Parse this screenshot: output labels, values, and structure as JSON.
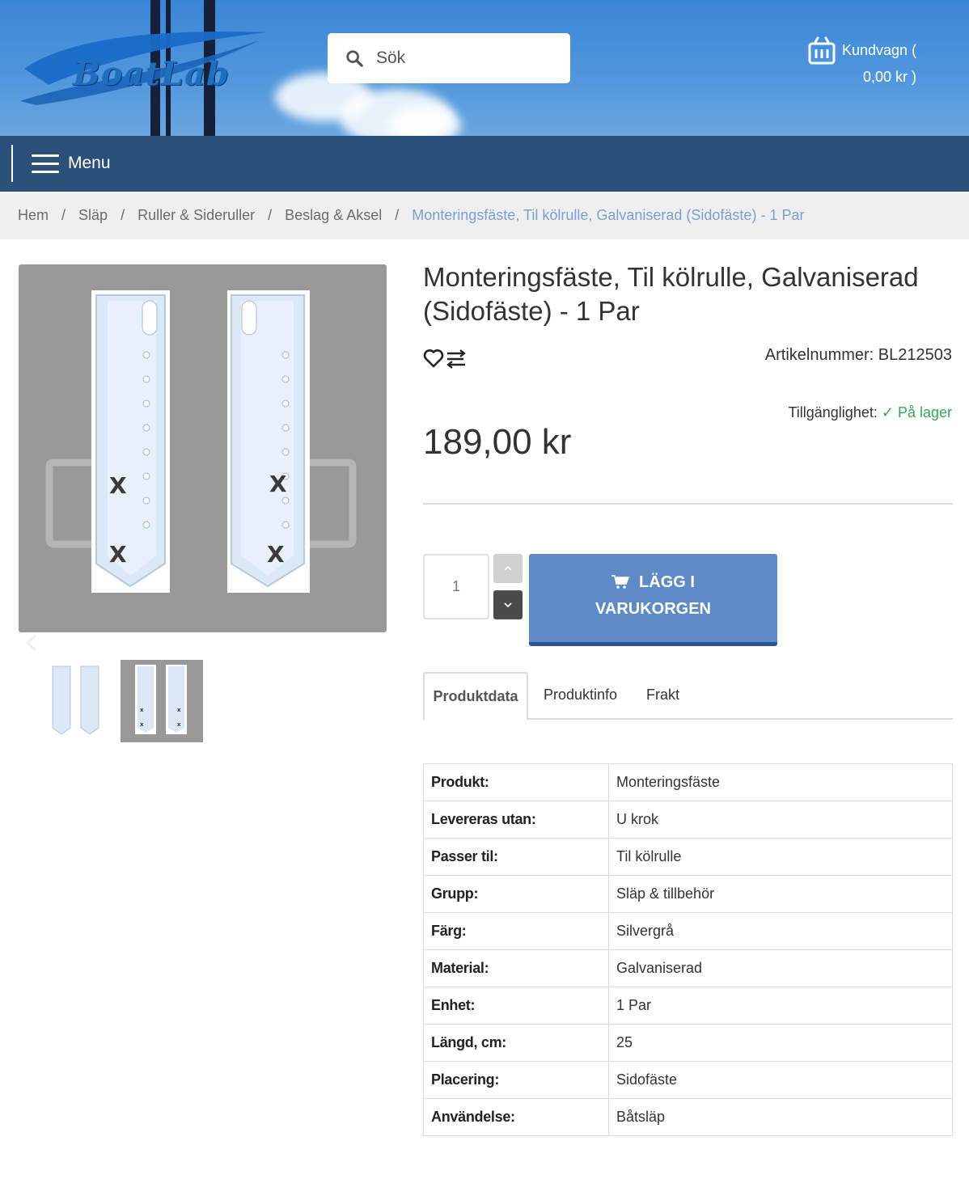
{
  "header": {
    "logo_text": "BoatLab",
    "search_placeholder": "Sök",
    "cart_label": "Kundvagn (",
    "cart_total": "0,00 kr )"
  },
  "nav": {
    "menu_label": "Menu"
  },
  "breadcrumb": {
    "items": [
      "Hem",
      "Släp",
      "Ruller & Sideruller",
      "Beslag & Aksel"
    ],
    "separator": "/",
    "current": "Monteringsfäste, Til kölrulle, Galvaniserad (Sidofäste) - 1 Par"
  },
  "product": {
    "title": "Monteringsfäste, Til kölrulle, Galvaniserad (Sidofäste) - 1 Par",
    "sku": "Artikelnummer: BL212503",
    "availability_label": "Tillgänglighet:",
    "availability_value": "✓ På lager",
    "price": "189,00 kr",
    "quantity": "1",
    "add_to_cart_line1": "LÄGG I",
    "add_to_cart_line2": "VARUKORGEN"
  },
  "tabs": [
    "Produktdata",
    "Produktinfo",
    "Frakt"
  ],
  "specs": [
    {
      "key": "Produkt:",
      "value": "Monteringsfäste"
    },
    {
      "key": "Levereras utan:",
      "value": "U krok"
    },
    {
      "key": "Passer til:",
      "value": "Til kölrulle"
    },
    {
      "key": "Grupp:",
      "value": "Släp & tillbehör"
    },
    {
      "key": "Färg:",
      "value": "Silvergrå"
    },
    {
      "key": "Material:",
      "value": "Galvaniserad"
    },
    {
      "key": "Enhet:",
      "value": "1 Par"
    },
    {
      "key": "Längd, cm:",
      "value": "25"
    },
    {
      "key": "Placering:",
      "value": "Sidofäste"
    },
    {
      "key": "Användelse:",
      "value": "Båtsläp"
    }
  ],
  "colors": {
    "header_blue": "#4a90d9",
    "nav_blue": "#2b5079",
    "button_blue": "#5f8ac8",
    "in_stock_green": "#3aa55a",
    "breadcrumb_current": "#7b9fd0"
  }
}
